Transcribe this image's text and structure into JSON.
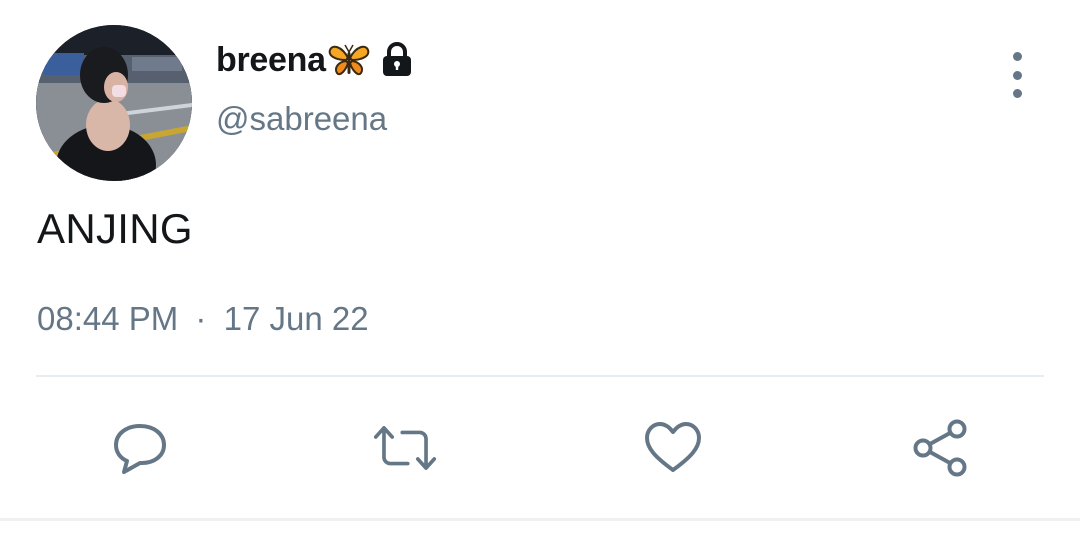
{
  "author": {
    "display_name": "breena",
    "display_name_emoji": "butterfly-icon",
    "protected_icon": "lock-icon",
    "handle": "@sabreena"
  },
  "tweet": {
    "text": "ANJING",
    "time": "08:44 PM",
    "separator": "·",
    "date": "17 Jun 22"
  },
  "actions": {
    "reply_icon": "reply-icon",
    "retweet_icon": "retweet-icon",
    "like_icon": "like-icon",
    "share_icon": "share-icon"
  },
  "colors": {
    "text": "#14171a",
    "secondary": "#657786",
    "divider": "#e6ecf0"
  }
}
